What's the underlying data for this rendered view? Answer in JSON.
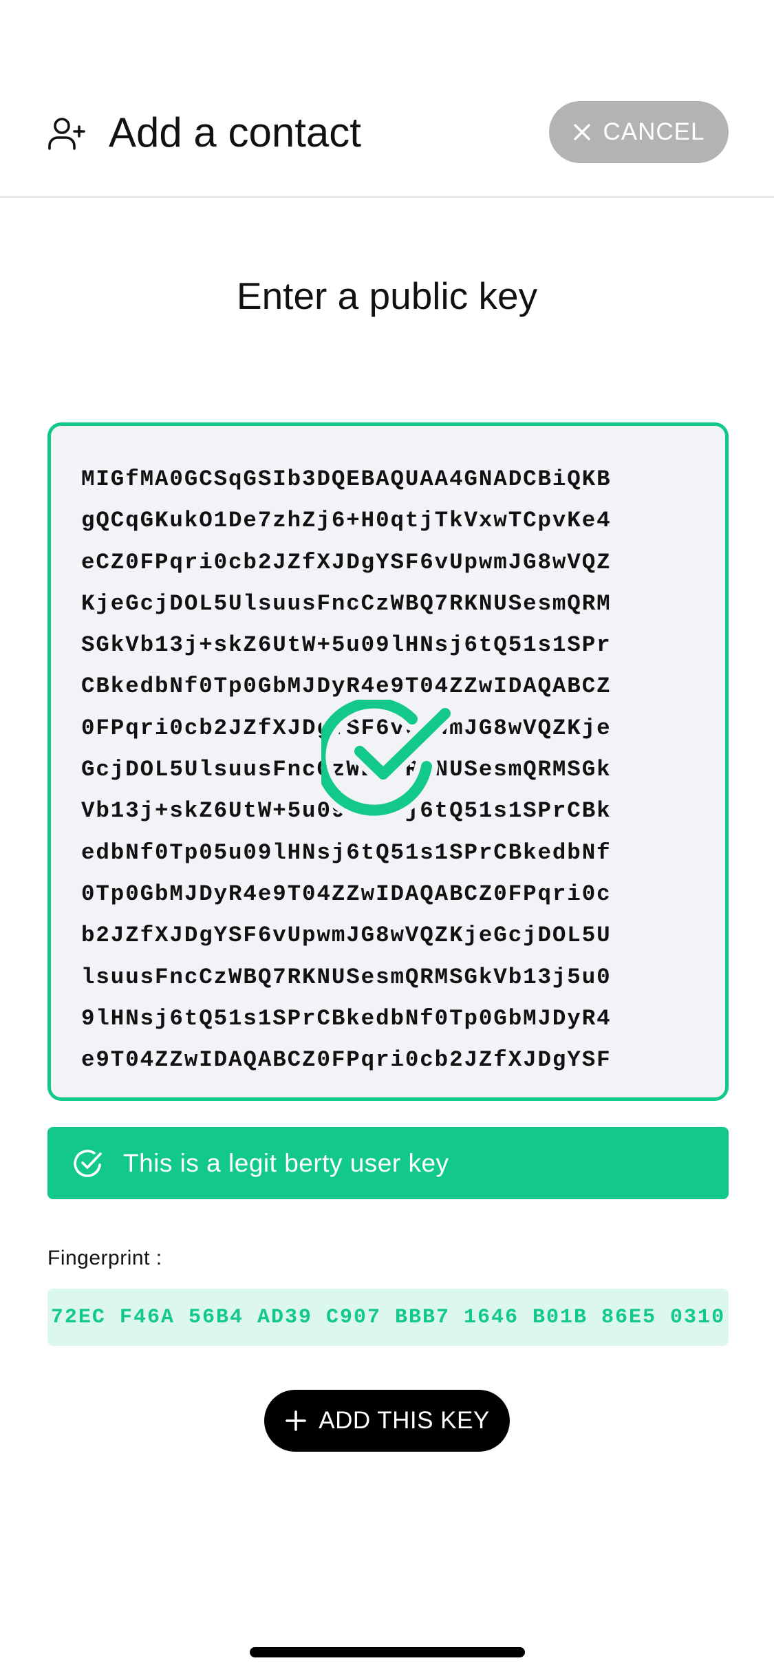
{
  "header": {
    "title": "Add a contact",
    "icon": "add-user-icon",
    "cancel_label": "CANCEL",
    "cancel_icon": "close-icon"
  },
  "section_title": "Enter a public key",
  "key_input": {
    "lines": [
      "MIGfMA0GCSqGSIb3DQEBAQUAA4GNADCBiQKB",
      "gQCqGKukO1De7zhZj6+H0qtjTkVxwTCpvKe4",
      "eCZ0FPqri0cb2JZfXJDgYSF6vUpwmJG8wVQZ",
      "KjeGcjDOL5UlsuusFncCzWBQ7RKNUSesmQRM",
      "SGkVb13j+skZ6UtW+5u09lHNsj6tQ51s1SPr",
      "CBkedbNf0Tp0GbMJDyR4e9T04ZZwIDAQABCZ",
      "0FPqri0cb2JZfXJDgYSF6vUpwmJG8wVQZKje",
      "GcjDOL5UlsuusFncCzWBQ7RKNUSesmQRMSGk",
      "Vb13j+skZ6UtW+5u09lHNsj6tQ51s1SPrCBk",
      "edbNf0Tp05u09lHNsj6tQ51s1SPrCBkedbNf",
      "0Tp0GbMJDyR4e9T04ZZwIDAQABCZ0FPqri0c",
      "b2JZfXJDgYSF6vUpwmJG8wVQZKjeGcjDOL5U",
      "lsuusFncCzWBQ7RKNUSesmQRMSGkVb13j5u0",
      "9lHNsj6tQ51s1SPrCBkedbNf0Tp0GbMJDyR4",
      "e9T04ZZwIDAQABCZ0FPqri0cb2JZfXJDgYSF"
    ],
    "status_icon": "check-circle-icon"
  },
  "validation": {
    "message": "This is a legit berty user key",
    "icon": "check-circle-icon"
  },
  "fingerprint": {
    "label": "Fingerprint :",
    "value": "72EC F46A 56B4 AD39 C907 BBB7 1646 B01B 86E5 0310"
  },
  "add_button": {
    "label": "ADD THIS KEY",
    "icon": "plus-icon"
  },
  "colors": {
    "accent": "#13c98a",
    "accent_light": "#dcf7ec",
    "cancel_bg": "#b3b3b3",
    "key_bg": "#f1f3f7",
    "primary_button": "#000000"
  }
}
